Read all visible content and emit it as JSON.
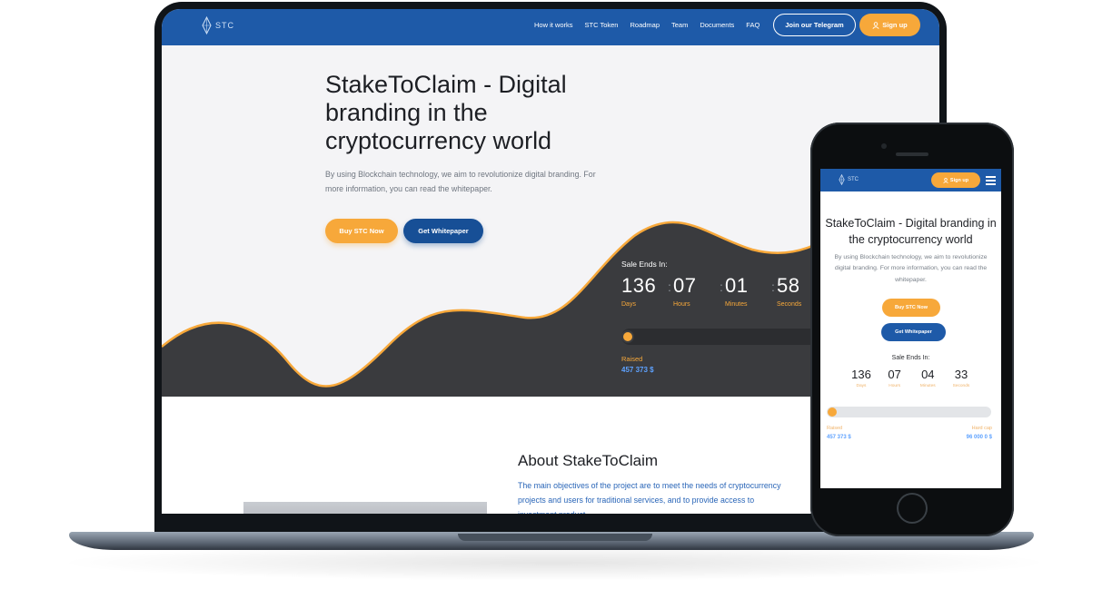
{
  "desktop": {
    "logo_text": "STC",
    "nav": [
      "How it works",
      "STC Token",
      "Roadmap",
      "Team",
      "Documents",
      "FAQ"
    ],
    "telegram_label": "Join our Telegram",
    "signup_label": "Sign up",
    "hero": {
      "title": "StakeToClaim - Digital branding in the cryptocurrency world",
      "description": "By using Blockchain technology, we aim to revolutionize digital branding. For more information, you can read the whitepaper.",
      "buy_label": "Buy STC Now",
      "whitepaper_label": "Get Whitepaper"
    },
    "sale": {
      "label": "Sale Ends In:",
      "days": "136",
      "hours": "07",
      "minutes": "01",
      "seconds": "58",
      "days_label": "Days",
      "hours_label": "Hours",
      "minutes_label": "Minutes",
      "seconds_label": "Seconds",
      "raised_label": "Raised",
      "raised_value": "457 373 $"
    },
    "about": {
      "title": "About StakeToClaim",
      "text": "The main objectives of the project are to meet the needs of cryptocurrency projects and users for traditional services, and to provide access to investment product"
    }
  },
  "mobile": {
    "logo_text": "STC",
    "signup_label": "Sign up",
    "title": "StakeToClaim - Digital branding in the cryptocurrency world",
    "description": "By using Blockchain technology, we aim to revolutionize digital branding. For more information, you can read the whitepaper.",
    "buy_label": "Buy STC Now",
    "whitepaper_label": "Get Whitepaper",
    "sale_label": "Sale Ends In:",
    "days": "136",
    "hours": "07",
    "minutes": "04",
    "seconds": "33",
    "days_label": "Days",
    "hours_label": "Hours",
    "minutes_label": "Minutes",
    "seconds_label": "Seconds",
    "raised_label": "Raised",
    "raised_value": "457 373 $",
    "hardcap_label": "Hard cap",
    "hardcap_value": "96 000 0 $"
  },
  "colors": {
    "header_blue": "#1e5aa8",
    "accent_orange": "#f7a83a",
    "wave_dark": "#3a3b3e",
    "raised_blue": "#5ea2ff"
  },
  "icons": [
    "stc-logo-icon",
    "user-icon",
    "hamburger-menu-icon"
  ]
}
